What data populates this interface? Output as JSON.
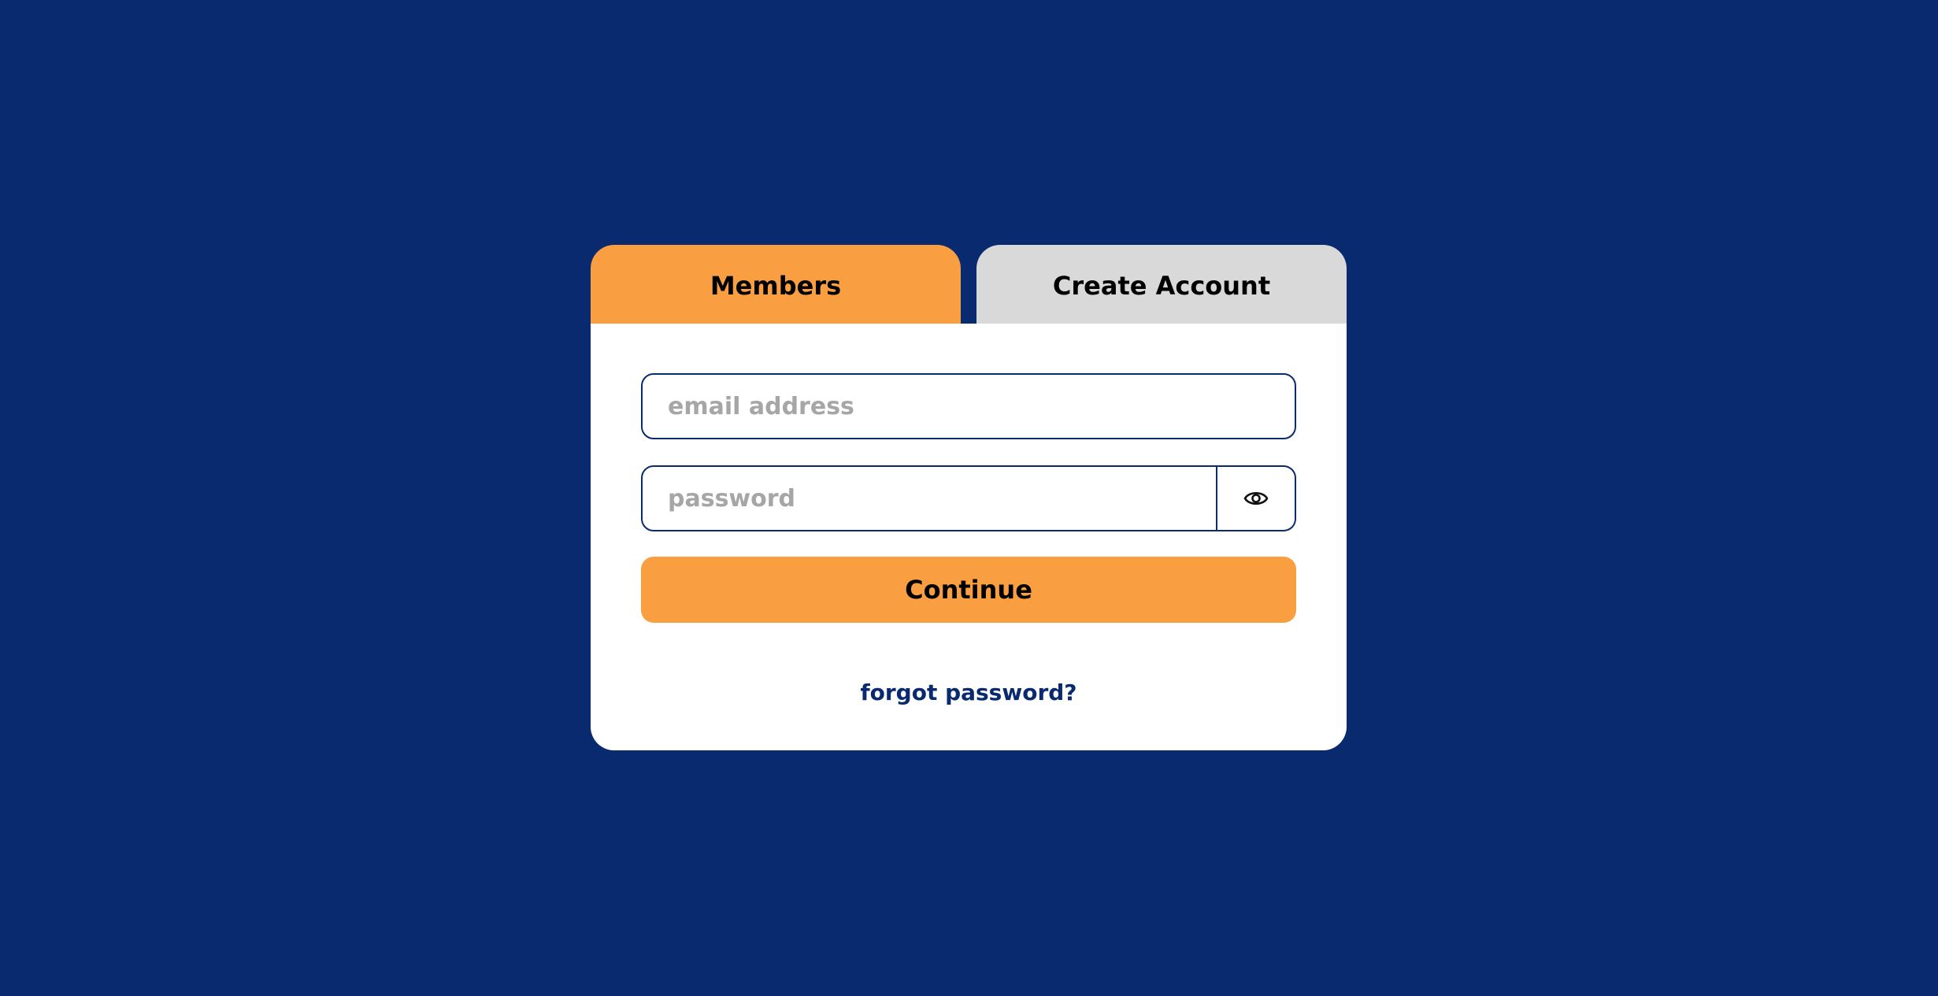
{
  "colors": {
    "background": "#092a6e",
    "accent": "#f99f42",
    "inactive_tab": "#d9d9d9",
    "panel": "#ffffff",
    "placeholder": "#a6a6a6",
    "link": "#092a6e"
  },
  "tabs": {
    "members_label": "Members",
    "create_label": "Create Account",
    "active": "Members"
  },
  "form": {
    "email": {
      "value": "",
      "placeholder": "email address"
    },
    "password": {
      "value": "",
      "placeholder": "password",
      "toggle_icon": "eye-icon"
    },
    "continue_label": "Continue",
    "forgot_label": "forgot password?"
  }
}
